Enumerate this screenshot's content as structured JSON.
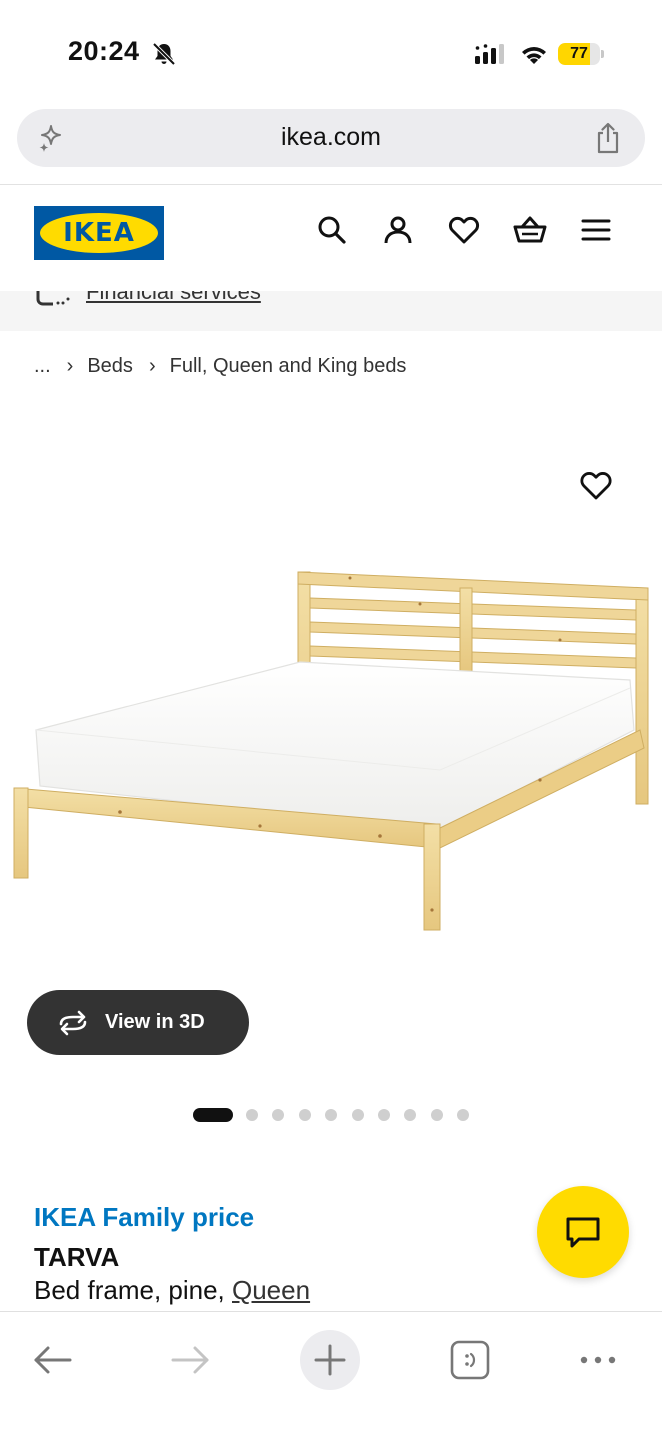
{
  "status_bar": {
    "time": "20:24",
    "battery_level": "77",
    "icons": [
      "bell-slash-icon",
      "cellular-signal-icon",
      "wifi-icon",
      "battery-icon"
    ]
  },
  "browser": {
    "url": "ikea.com",
    "icons": [
      "sparkle-icon",
      "share-icon"
    ]
  },
  "header": {
    "logo_text": "IKEA",
    "icons": [
      "search-icon",
      "account-icon",
      "heart-icon",
      "basket-icon",
      "menu-icon"
    ],
    "brand_blue": "#0058a3",
    "brand_yellow": "#ffdb00"
  },
  "financial": {
    "link": "Financial services"
  },
  "breadcrumb": {
    "items": [
      "...",
      "Beds",
      "Full, Queen and King beds"
    ]
  },
  "gallery": {
    "view_3d_label": "View in 3D",
    "total_images": 10,
    "active_index": 0
  },
  "product": {
    "price_label": "IKEA Family price",
    "name": "TARVA",
    "description": "Bed frame, pine, ",
    "size": "Queen",
    "price_color": "#0077c1"
  },
  "chat": {
    "icon": "chat-icon"
  },
  "toolbar": {
    "icons": [
      "back-arrow-icon",
      "forward-arrow-icon",
      "new-tab-icon",
      "tabs-icon",
      "more-icon"
    ]
  }
}
